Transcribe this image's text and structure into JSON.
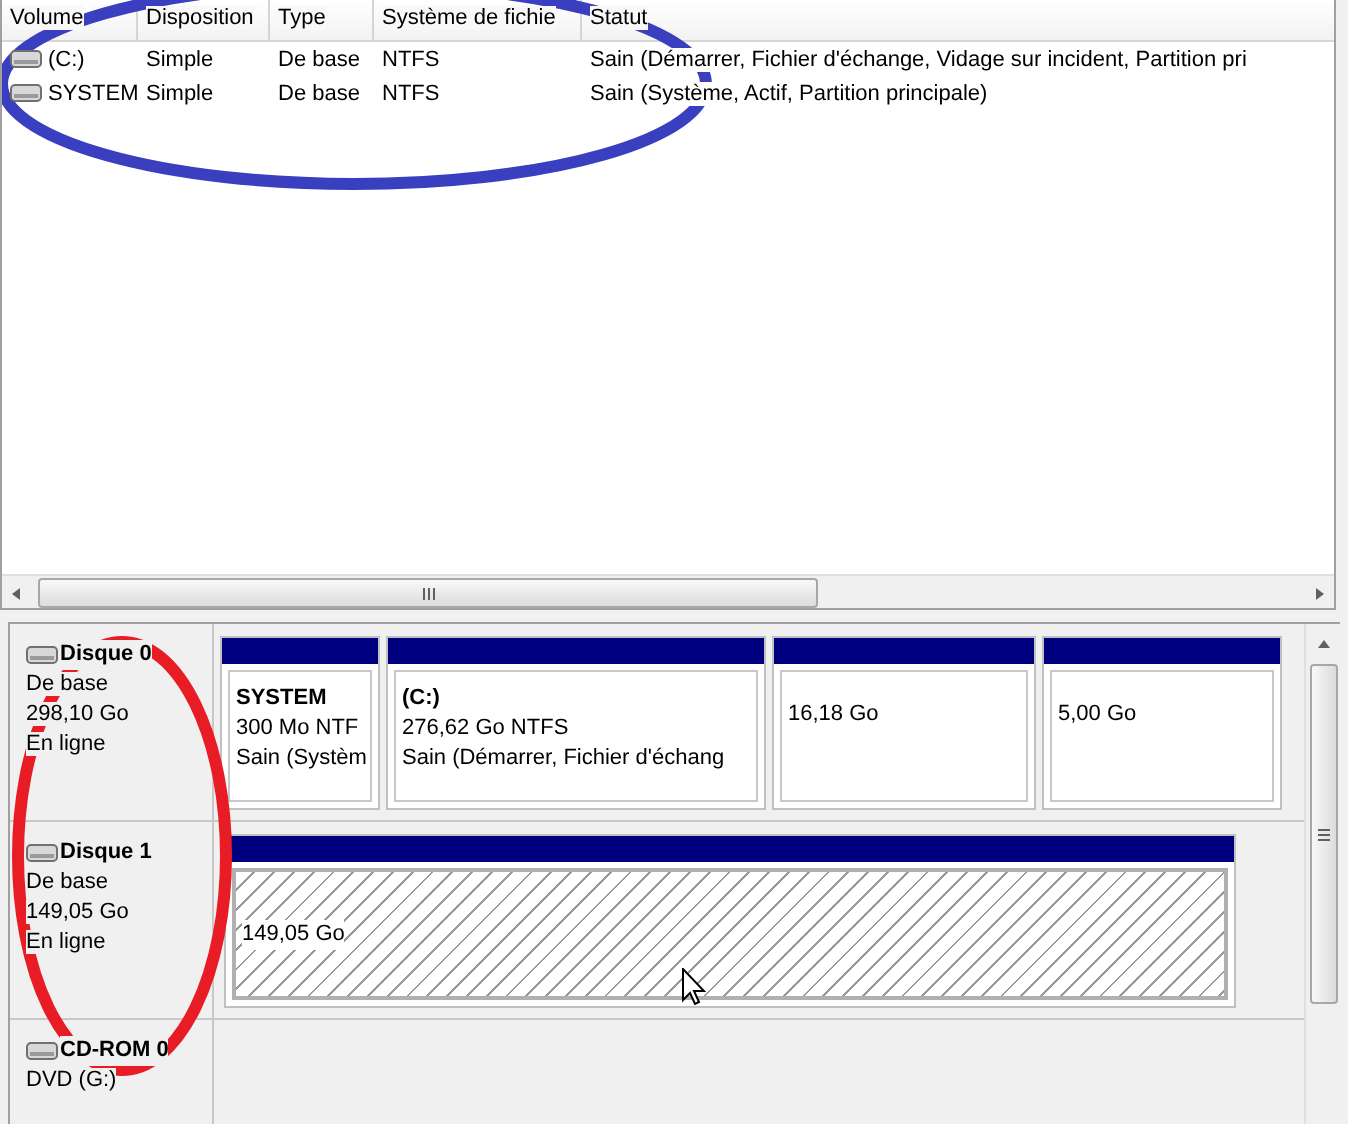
{
  "volume_list": {
    "columns": [
      "Volume",
      "Disposition",
      "Type",
      "Système de fichie",
      "Statut"
    ],
    "rows": [
      {
        "cells": [
          "(C:)",
          "Simple",
          "De base",
          "NTFS",
          "Sain (Démarrer, Fichier d'échange, Vidage sur incident, Partition pri"
        ]
      },
      {
        "cells": [
          "SYSTEM",
          "Simple",
          "De base",
          "NTFS",
          "Sain (Système, Actif, Partition principale)"
        ]
      }
    ]
  },
  "disks": [
    {
      "name": "Disque 0",
      "type": "De base",
      "size": "298,10 Go",
      "status": "En ligne",
      "partitions": [
        {
          "kind": "primary",
          "title": "SYSTEM",
          "lines": [
            "300 Mo NTF",
            "Sain (Systèm"
          ]
        },
        {
          "kind": "primary",
          "title": "(C:)",
          "lines": [
            "276,62 Go NTFS",
            "Sain (Démarrer, Fichier d'échang"
          ]
        },
        {
          "kind": "primary",
          "lines": [
            "16,18 Go"
          ]
        },
        {
          "kind": "primary",
          "lines": [
            "5,00 Go"
          ]
        }
      ]
    },
    {
      "name": "Disque 1",
      "type": "De base",
      "size": "149,05 Go",
      "status": "En ligne",
      "partitions": [
        {
          "kind": "unallocated",
          "lines": [
            "149,05 Go"
          ]
        }
      ]
    }
  ],
  "cdrom": {
    "name": "CD-ROM 0",
    "drive": "DVD (G:)"
  }
}
